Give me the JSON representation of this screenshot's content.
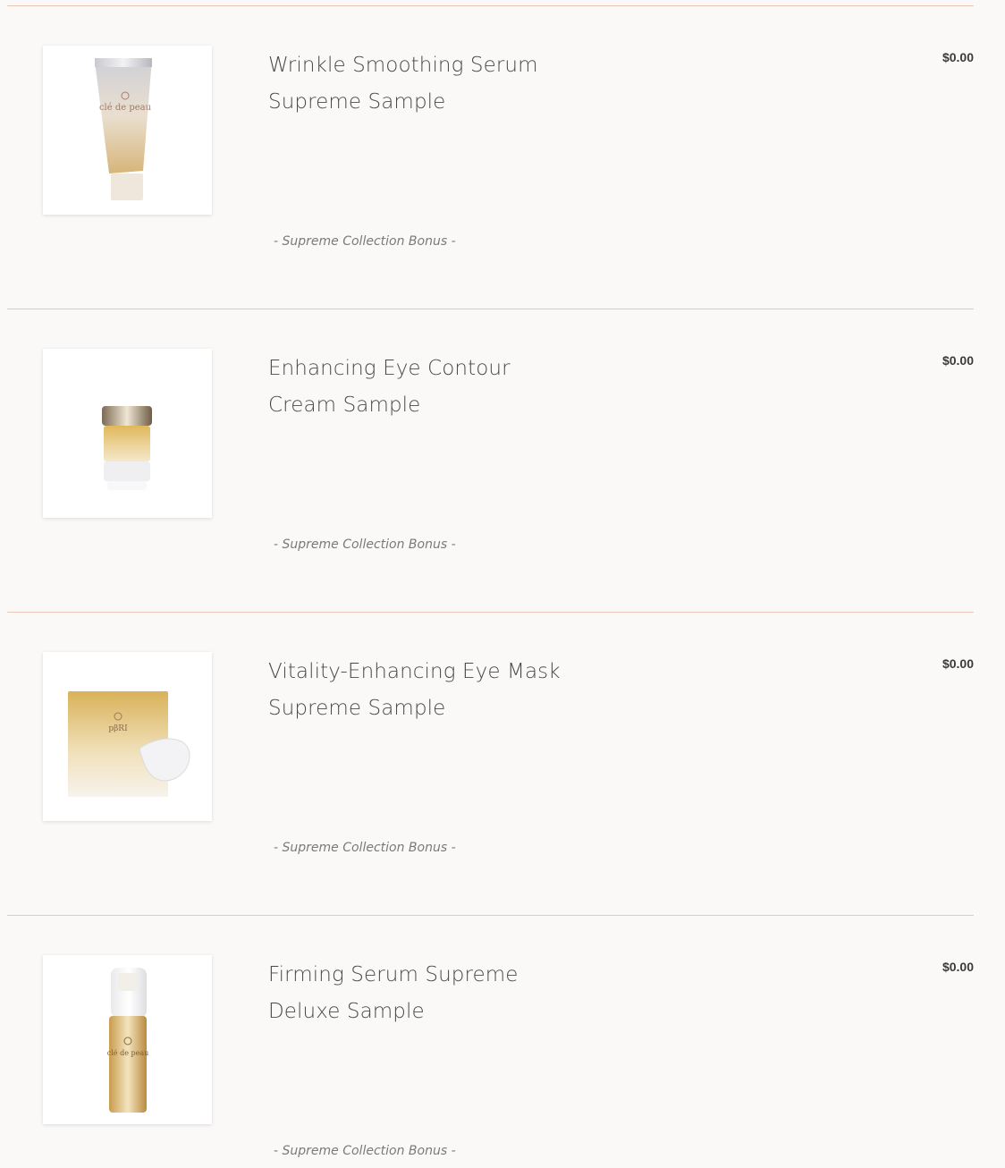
{
  "items": [
    {
      "title_line1": "Wrinkle Smoothing Serum",
      "title_line2": "Supreme Sample",
      "price": "$0.00",
      "note": "- Supreme Collection Bonus -",
      "image": "serum-tube-image"
    },
    {
      "title_line1": "Enhancing Eye Contour",
      "title_line2": "Cream Sample",
      "price": "$0.00",
      "note": "- Supreme Collection Bonus -",
      "image": "eye-cream-jar-image"
    },
    {
      "title_line1": "Vitality-Enhancing Eye Mask",
      "title_line2": "Supreme Sample",
      "price": "$0.00",
      "note": "- Supreme Collection Bonus -",
      "image": "eye-mask-packet-image"
    },
    {
      "title_line1": "Firming Serum Supreme",
      "title_line2": "Deluxe Sample",
      "price": "$0.00",
      "note": "- Supreme Collection Bonus -",
      "image": "serum-pump-bottle-image"
    }
  ],
  "colors": {
    "background": "#fbf8f8",
    "divider": "#e9c8b8",
    "gold": "#d9b878"
  }
}
